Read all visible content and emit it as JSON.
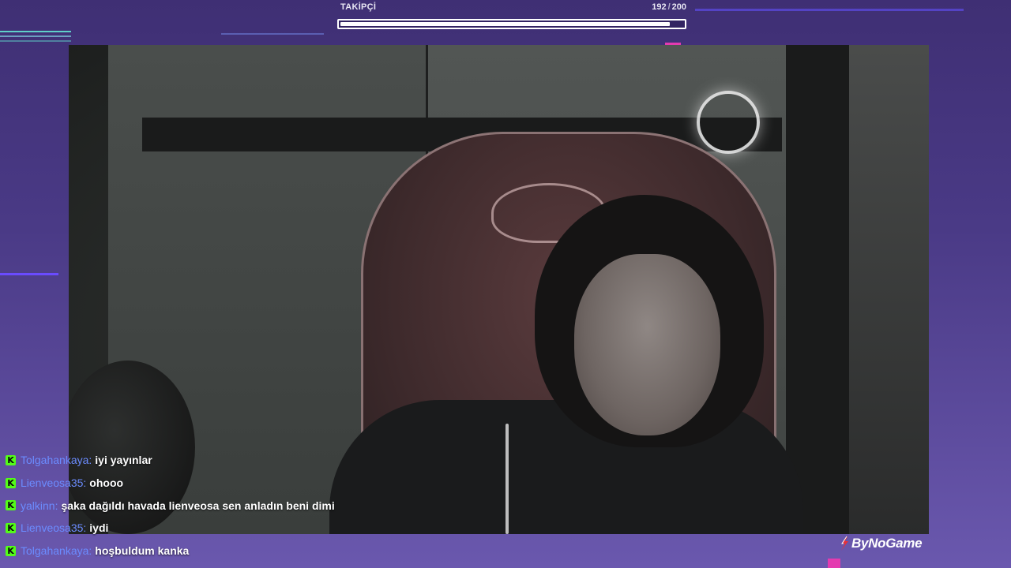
{
  "follower_goal": {
    "label": "TAKİPÇİ",
    "current": "192",
    "separator": "/",
    "target": "200",
    "progress": 0.96
  },
  "chat": {
    "platform_icon": "kick-icon",
    "messages": [
      {
        "user": "Tolgahankaya",
        "colon": ":",
        "text": "iyi yayınlar"
      },
      {
        "user": "Lienveosa35",
        "colon": ":",
        "text": "ohooo"
      },
      {
        "user": "yalkinn",
        "colon": ":",
        "text": "şaka dağıldı havada lienveosa sen anladın beni dimi"
      },
      {
        "user": "Lienveosa35",
        "colon": ":",
        "text": "iydi"
      },
      {
        "user": "Tolgahankaya",
        "colon": ":",
        "text": "hoşbuldum kanka"
      }
    ]
  },
  "branding": {
    "logo_text": "ByNoGame",
    "accent": "#e8303a"
  },
  "colors": {
    "username": "#6b8cff",
    "kick_green": "#53fc18",
    "background": "#4a3a86"
  }
}
